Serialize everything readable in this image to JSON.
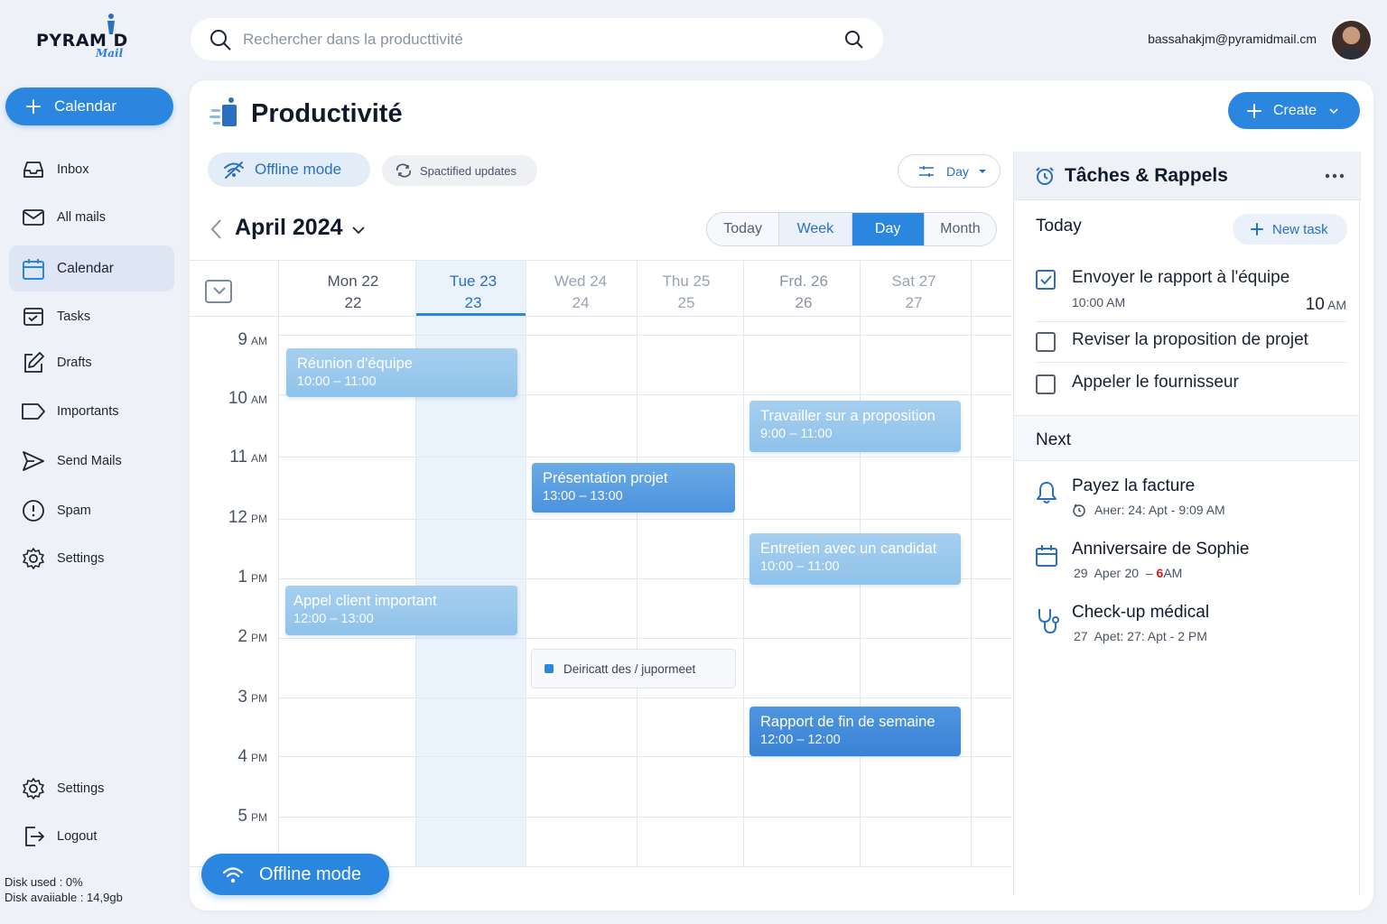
{
  "app": {
    "logo_text": "PYRAM D",
    "logo_sub": "Mail"
  },
  "sidebar": {
    "compose_label": "Calendar",
    "items": [
      {
        "label": "Inbox",
        "icon": "inbox-icon"
      },
      {
        "label": "All mails",
        "icon": "mail-icon"
      },
      {
        "label": "Calendar",
        "icon": "calendar-icon",
        "active": true
      },
      {
        "label": "Tasks",
        "icon": "tasks-icon"
      },
      {
        "label": "Drafts",
        "icon": "edit-icon"
      },
      {
        "label": "Importants",
        "icon": "label-icon"
      },
      {
        "label": "Send Mails",
        "icon": "send-icon"
      },
      {
        "label": "Spam",
        "icon": "alert-icon"
      },
      {
        "label": "Settings",
        "icon": "gear-icon"
      }
    ],
    "bottom": [
      {
        "label": "Settings",
        "icon": "gear-icon"
      },
      {
        "label": "Logout",
        "icon": "logout-icon"
      }
    ],
    "disk_used": "Disk used : 0%",
    "disk_available": "Disk avaiiable : 14,9gb"
  },
  "search": {
    "placeholder": "Rechercher dans la producttivité"
  },
  "user": {
    "email": "bassahakjm@pyramidmail.cm"
  },
  "header": {
    "title": "Productivité",
    "create_label": "Create"
  },
  "toolbar": {
    "offline_label": "Offline mode",
    "updates_label": "Spactified updates",
    "day_select": "Day"
  },
  "calendar": {
    "month_label": "April 2024",
    "views": [
      "Today",
      "Week",
      "Day",
      "Month"
    ],
    "active_view": "Day",
    "days": [
      {
        "name": "Mon 22",
        "num": "22"
      },
      {
        "name": "Tue 23",
        "num": "23",
        "selected": true
      },
      {
        "name": "Wed 24",
        "num": "24"
      },
      {
        "name": "Thu 25",
        "num": "25"
      },
      {
        "name": "Frd. 26",
        "num": "26"
      },
      {
        "name": "Sat 27",
        "num": "27"
      }
    ],
    "hours": [
      {
        "n": "9",
        "s": "AM"
      },
      {
        "n": "10",
        "s": "AM"
      },
      {
        "n": "11",
        "s": "AM"
      },
      {
        "n": "12",
        "s": "PM"
      },
      {
        "n": "1",
        "s": "PM"
      },
      {
        "n": "2",
        "s": "PM"
      },
      {
        "n": "3",
        "s": "PM"
      },
      {
        "n": "4",
        "s": "PM"
      },
      {
        "n": "5",
        "s": "PM"
      }
    ],
    "events": [
      {
        "title": "Réunion d'équipe",
        "time": "10:00 – 11:00"
      },
      {
        "title": "Travailler sur a proposition",
        "time": "9:00 – 11:00"
      },
      {
        "title": "Présentation projet",
        "time": "13:00 – 13:00"
      },
      {
        "title": "Entretien avec un candidat",
        "time": "10:00 – 11:00"
      },
      {
        "title": "Appel client important",
        "time": "12:00 – 13:00"
      },
      {
        "title": "Rapport de fin de semaine",
        "time": "12:00 – 12:00"
      }
    ],
    "note_label": "Deiricatt des / jupormeet",
    "offline_button": "Offline mode"
  },
  "tasks_panel": {
    "title": "Tâches & Rappels",
    "today_label": "Today",
    "new_task_label": "New task",
    "tasks": [
      {
        "label": "Envoyer le rapport à l'équipe",
        "time": "10:00 AM",
        "time_right_num": "10",
        "time_right_suffix": "AM",
        "checked": true
      },
      {
        "label": "Reviser la proposition de projet",
        "checked": false
      },
      {
        "label": "Appeler le fournisseur",
        "checked": false
      }
    ],
    "next_label": "Next",
    "reminders": [
      {
        "title": "Payez la facture",
        "detail": "Aнer: 24: Apt - 9:09 AM",
        "icon": "bell-icon"
      },
      {
        "title": "Anniversaire de Sophie",
        "detail_a": "29  Apeг 20  – ",
        "detail_b": "6",
        "detail_c": "AM",
        "icon": "calendar-icon"
      },
      {
        "title": "Check-up médical",
        "detail": "27  Apet: 27: Apt - 2 PM",
        "icon": "stethoscope-icon"
      }
    ]
  },
  "colors": {
    "accent": "#2a86de",
    "event_light": "#9ccaee",
    "event_dark": "#3a82d4",
    "deadline": "#d11a1a"
  }
}
